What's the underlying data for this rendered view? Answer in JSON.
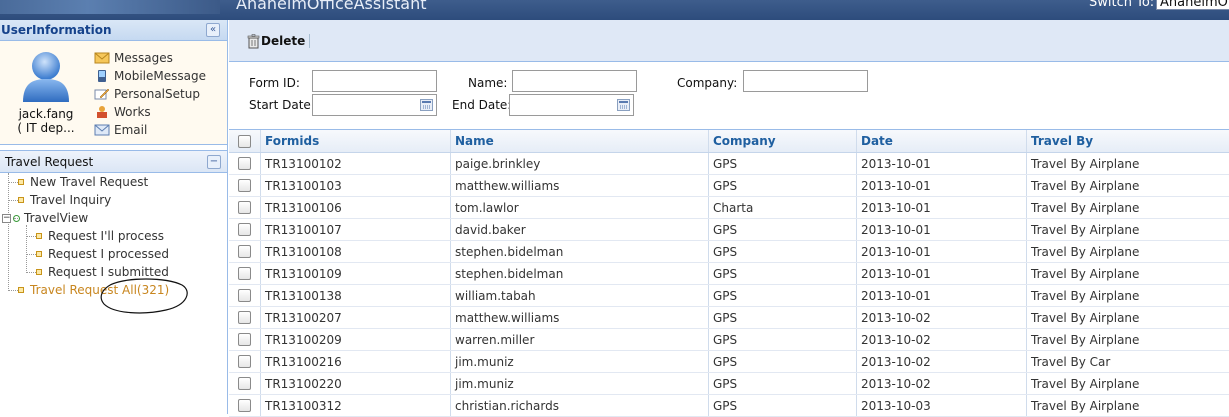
{
  "header": {
    "app_title": "AnaheimOfficeAssistant",
    "switch_label": "Switch To:",
    "switch_value": "AnaheimOf"
  },
  "user_panel": {
    "title": "UserInformation",
    "user_name": "jack.fang",
    "user_dept": "( IT dep...",
    "links": [
      {
        "label": "Messages",
        "icon": "envelope-icon"
      },
      {
        "label": "MobileMessage",
        "icon": "mobile-phone-icon"
      },
      {
        "label": "PersonalSetup",
        "icon": "edit-pencil-icon"
      },
      {
        "label": "Works",
        "icon": "work-person-icon"
      },
      {
        "label": "Email",
        "icon": "email-icon"
      }
    ]
  },
  "tree": {
    "title": "Travel Request",
    "items": [
      {
        "label": "New Travel Request"
      },
      {
        "label": "Travel Inquiry"
      },
      {
        "label": "TravelView"
      },
      {
        "label": "Request I'll process"
      },
      {
        "label": "Request I processed"
      },
      {
        "label": "Request I submitted"
      },
      {
        "label": "Travel Request All(321)"
      }
    ]
  },
  "toolbar": {
    "delete_label": "Delete"
  },
  "filters": {
    "form_id_label": "Form ID:",
    "name_label": "Name:",
    "company_label": "Company:",
    "start_date_label": "Start Date:",
    "end_date_label": "End Date:",
    "form_id_value": "",
    "name_value": "",
    "company_value": "",
    "start_date_value": "",
    "end_date_value": ""
  },
  "table": {
    "columns": [
      "Formids",
      "Name",
      "Company",
      "Date",
      "Travel By"
    ],
    "rows": [
      [
        "TR13100102",
        "paige.brinkley",
        "GPS",
        "2013-10-01",
        "Travel By Airplane"
      ],
      [
        "TR13100103",
        "matthew.williams",
        "GPS",
        "2013-10-01",
        "Travel By Airplane"
      ],
      [
        "TR13100106",
        "tom.lawlor",
        "Charta",
        "2013-10-01",
        "Travel By Airplane"
      ],
      [
        "TR13100107",
        "david.baker",
        "GPS",
        "2013-10-01",
        "Travel By Airplane"
      ],
      [
        "TR13100108",
        "stephen.bidelman",
        "GPS",
        "2013-10-01",
        "Travel By Airplane"
      ],
      [
        "TR13100109",
        "stephen.bidelman",
        "GPS",
        "2013-10-01",
        "Travel By Airplane"
      ],
      [
        "TR13100138",
        "william.tabah",
        "GPS",
        "2013-10-01",
        "Travel By Airplane"
      ],
      [
        "TR13100207",
        "matthew.williams",
        "GPS",
        "2013-10-02",
        "Travel By Airplane"
      ],
      [
        "TR13100209",
        "warren.miller",
        "GPS",
        "2013-10-02",
        "Travel By Airplane"
      ],
      [
        "TR13100216",
        "jim.muniz",
        "GPS",
        "2013-10-02",
        "Travel By Car"
      ],
      [
        "TR13100220",
        "jim.muniz",
        "GPS",
        "2013-10-02",
        "Travel By Airplane"
      ],
      [
        "TR13100312",
        "christian.richards",
        "GPS",
        "2013-10-03",
        "Travel By Airplane"
      ]
    ]
  },
  "colors": {
    "header_bg": "#2d4c7c",
    "panel_border": "#99bbe8",
    "column_header_text": "#1f5fa0",
    "selected_tree_item": "#c8861f"
  }
}
